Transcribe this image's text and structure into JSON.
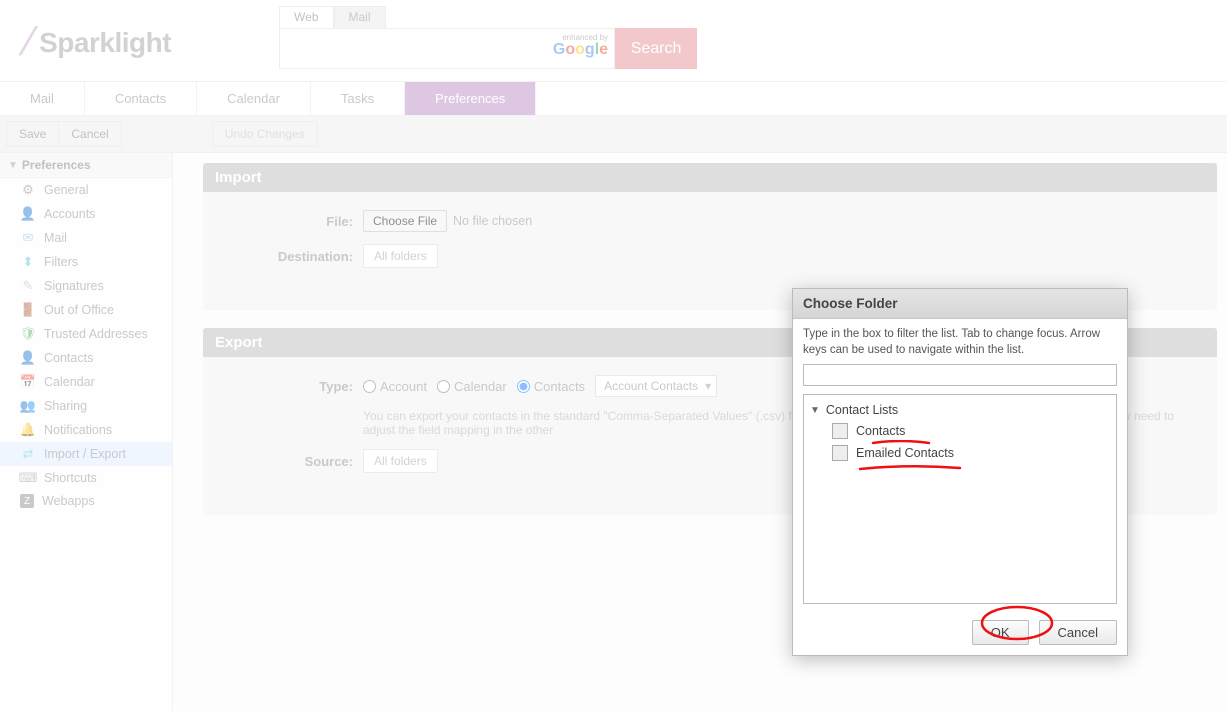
{
  "logo": {
    "text": "Sparklight"
  },
  "search": {
    "tabs": {
      "web": "Web",
      "mail": "Mail"
    },
    "enhanced_by": "enhanced by",
    "button": "Search"
  },
  "nav": {
    "mail": "Mail",
    "contacts": "Contacts",
    "calendar": "Calendar",
    "tasks": "Tasks",
    "preferences": "Preferences"
  },
  "toolbar": {
    "save": "Save",
    "cancel": "Cancel",
    "undo": "Undo Changes"
  },
  "sidebar": {
    "header": "Preferences",
    "items": {
      "general": "General",
      "accounts": "Accounts",
      "mail": "Mail",
      "filters": "Filters",
      "signatures": "Signatures",
      "ooo": "Out of Office",
      "trusted": "Trusted Addresses",
      "contacts": "Contacts",
      "calendar": "Calendar",
      "sharing": "Sharing",
      "notifications": "Notifications",
      "import_export": "Import / Export",
      "shortcuts": "Shortcuts",
      "webapps": "Webapps"
    }
  },
  "import": {
    "header": "Import",
    "file_label": "File:",
    "choose_file": "Choose File",
    "no_file": "No file chosen",
    "dest_label": "Destination:",
    "dest_value": "All folders"
  },
  "export": {
    "header": "Export",
    "type_label": "Type:",
    "radio_account": "Account",
    "radio_calendar": "Calendar",
    "radio_contacts": "Contacts",
    "select_value": "Account Contacts",
    "hint": "You can export your contacts in the standard \"Comma-Separated Values\" (.csv) format, then import them into another contact manager. You may need to adjust the field mapping in the other",
    "source_label": "Source:",
    "source_value": "All folders"
  },
  "modal": {
    "title": "Choose Folder",
    "hint": "Type in the box to filter the list. Tab to change focus. Arrow keys can be used to navigate within the list.",
    "root": "Contact Lists",
    "child_contacts": "Contacts",
    "child_emailed": "Emailed Contacts",
    "ok": "OK",
    "cancel": "Cancel"
  }
}
